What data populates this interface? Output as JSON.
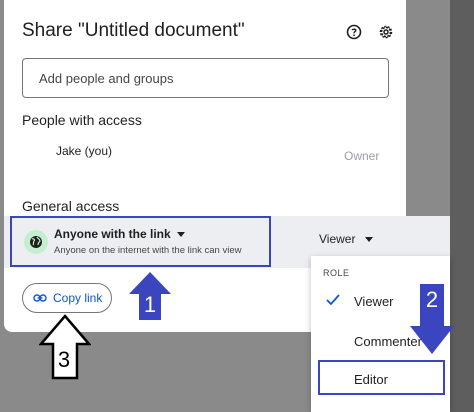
{
  "dialog": {
    "title": "Share \"Untitled document\"",
    "help_icon": "help-circle-icon",
    "settings_icon": "gear-icon",
    "add_people_placeholder": "Add people and groups"
  },
  "people_with_access": {
    "heading": "People with access",
    "person_name": "Jake (you)",
    "person_role": "Owner"
  },
  "general_access": {
    "heading": "General access",
    "scope": "Anyone with the link",
    "description": "Anyone on the internet with the link can view",
    "role": "Viewer",
    "icon": "globe-icon"
  },
  "copy_link": {
    "label": "Copy link",
    "icon": "link-icon"
  },
  "role_menu": {
    "header": "ROLE",
    "items": [
      "Viewer",
      "Commenter",
      "Editor"
    ],
    "selected": "Viewer"
  },
  "annotations": {
    "step1": "1",
    "step2": "2",
    "step3": "3",
    "accent": "#3c45c0"
  }
}
